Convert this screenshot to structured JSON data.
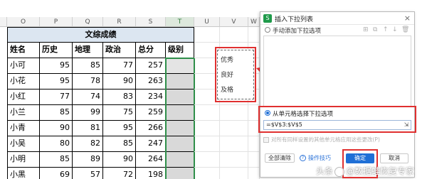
{
  "sheet": {
    "columns": [
      "O",
      "P",
      "Q",
      "R",
      "S",
      "T",
      "U",
      "V",
      "W"
    ],
    "title": "文综成绩",
    "headers": [
      "姓名",
      "历史",
      "地理",
      "政治",
      "总分",
      "级别"
    ],
    "rows": [
      {
        "name": "小可",
        "history": "95",
        "geo": "85",
        "politics": "77",
        "total": "257"
      },
      {
        "name": "小花",
        "history": "95",
        "geo": "78",
        "politics": "90",
        "total": "263"
      },
      {
        "name": "小红",
        "history": "77",
        "geo": "74",
        "politics": "83",
        "total": "234"
      },
      {
        "name": "小兰",
        "history": "85",
        "geo": "99",
        "politics": "75",
        "total": "259"
      },
      {
        "name": "小青",
        "history": "90",
        "geo": "81",
        "politics": "95",
        "total": "266"
      },
      {
        "name": "小吴",
        "history": "80",
        "geo": "82",
        "politics": "85",
        "total": "247"
      },
      {
        "name": "小明",
        "history": "85",
        "geo": "89",
        "politics": "90",
        "total": "264"
      },
      {
        "name": "小黑",
        "history": "69",
        "geo": "57",
        "politics": "72",
        "total": "198"
      }
    ],
    "dropdown_source": [
      "优秀",
      "良好",
      "及格"
    ]
  },
  "dialog": {
    "title": "插入下拉列表",
    "close_icon": "×",
    "option_manual": "手动添加下拉选项",
    "option_from_cells": "从单元格选择下拉选项",
    "range_value": "=$V$3:$V$5",
    "apply_same_label": "对所有同样设置的其他单元格应用这些更改(P)",
    "clear_all": "全部清除",
    "tips": "操作技巧",
    "ok": "确定",
    "cancel": "取消",
    "accent_color": "#1f6fd6",
    "highlight_color": "#e03030"
  },
  "watermark": {
    "text_left": "头条",
    "text_right": "@数据蛙恢复专家"
  }
}
